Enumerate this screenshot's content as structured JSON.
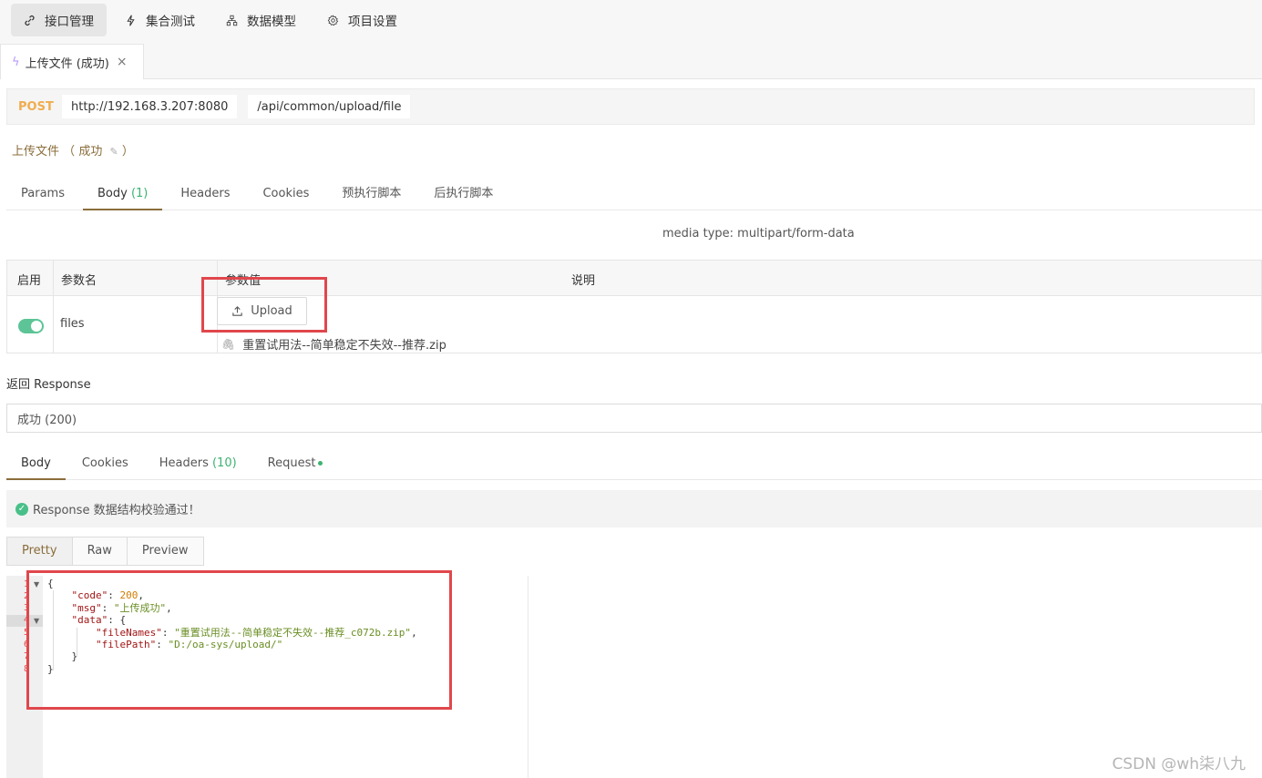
{
  "topnav": {
    "items": [
      {
        "label": "接口管理",
        "icon": "link-icon",
        "active": true
      },
      {
        "label": "集合测试",
        "icon": "bolt-icon",
        "active": false
      },
      {
        "label": "数据模型",
        "icon": "model-icon",
        "active": false
      },
      {
        "label": "项目设置",
        "icon": "gear-icon",
        "active": false
      }
    ]
  },
  "doc_tab": {
    "label": "上传文件 (成功)",
    "close": "×"
  },
  "request": {
    "method": "POST",
    "host": "http://192.168.3.207:8080",
    "path": "/api/common/upload/file"
  },
  "subtitle": {
    "name": "上传文件",
    "open": "（",
    "status": "成功",
    "close": "）"
  },
  "request_tabs": [
    {
      "label": "Params",
      "count": ""
    },
    {
      "label": "Body",
      "count": "(1)",
      "active": true
    },
    {
      "label": "Headers",
      "count": ""
    },
    {
      "label": "Cookies",
      "count": ""
    },
    {
      "label": "预执行脚本",
      "count": ""
    },
    {
      "label": "后执行脚本",
      "count": ""
    }
  ],
  "media_type": "media type: multipart/form-data",
  "params_table": {
    "headers": [
      "启用",
      "参数名",
      "参数值",
      "说明"
    ],
    "rows": [
      {
        "enabled": true,
        "name": "files",
        "upload_label": "Upload",
        "file": "重置试用法--简单稳定不失效--推荐.zip"
      }
    ]
  },
  "response": {
    "label": "返回 Response",
    "selected": "成功 (200)"
  },
  "response_tabs": [
    {
      "label": "Body",
      "count": "",
      "active": true
    },
    {
      "label": "Cookies",
      "count": ""
    },
    {
      "label": "Headers",
      "count": "(10)"
    },
    {
      "label": "Request",
      "count": ""
    }
  ],
  "verify_message": "Response 数据结构校验通过！",
  "view_tabs": [
    {
      "label": "Pretty",
      "active": true
    },
    {
      "label": "Raw"
    },
    {
      "label": "Preview"
    }
  ],
  "code_lines": [
    "1",
    "2",
    "3",
    "4",
    "5",
    "6",
    "7",
    "8"
  ],
  "json_body": {
    "code_key": "\"code\"",
    "code_val": "200",
    "msg_key": "\"msg\"",
    "msg_val": "\"上传成功\"",
    "data_key": "\"data\"",
    "fileNames_key": "\"fileNames\"",
    "fileNames_val": "\"重置试用法--简单稳定不失效--推荐_c072b.zip\"",
    "filePath_key": "\"filePath\"",
    "filePath_val": "\"D:/oa-sys/upload/\""
  },
  "watermark": "CSDN @wh柒八九",
  "colors": {
    "accent": "#8a6d3b",
    "method": "#f0ad4e",
    "success": "#3cb371",
    "annotation_red": "#e0474c"
  }
}
